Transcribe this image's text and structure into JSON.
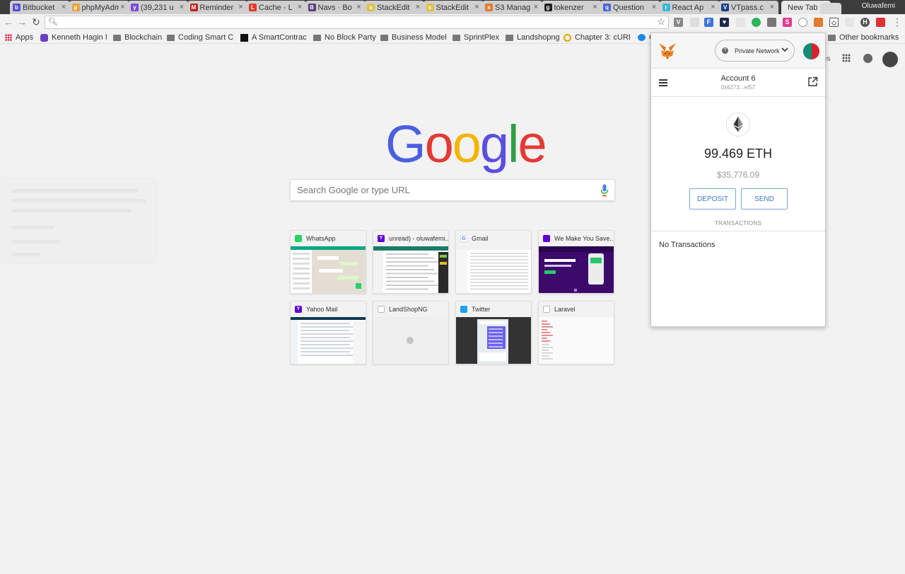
{
  "browser": {
    "tabs": [
      {
        "label": "Bitbucket",
        "color": "#5a4bd6",
        "glyph": "b"
      },
      {
        "label": "phpMyAdmin",
        "color": "#e8a33c",
        "glyph": "p"
      },
      {
        "label": "(39,231 u",
        "color": "#7b4bd6",
        "glyph": "y"
      },
      {
        "label": "Reminder",
        "color": "#c5221f",
        "glyph": "M"
      },
      {
        "label": "Cache - L",
        "color": "#e23a2f",
        "glyph": "L"
      },
      {
        "label": "Navs · Bo",
        "color": "#563d7c",
        "glyph": "B"
      },
      {
        "label": "StackEdit",
        "color": "#e0c24a",
        "glyph": "s"
      },
      {
        "label": "StackEdit",
        "color": "#e0c24a",
        "glyph": "s"
      },
      {
        "label": "S3 Manag",
        "color": "#e07b2f",
        "glyph": "s"
      },
      {
        "label": "tokenzer",
        "color": "#222222",
        "glyph": "g"
      },
      {
        "label": "Question",
        "color": "#4b67d6",
        "glyph": "q"
      },
      {
        "label": "React Ap",
        "color": "#3bb9d8",
        "glyph": "r"
      },
      {
        "label": "VTpass.c",
        "color": "#1b3c8a",
        "glyph": "V"
      }
    ],
    "active_tab_label": "New Tab",
    "user_name": "Oluwafemi",
    "address_value": "",
    "bookmarks": {
      "apps_label": "Apps",
      "items": [
        "Kenneth Hagin M",
        "Blockchain",
        "Coding Smart Co",
        "A SmartContract",
        "No Block Party",
        "Business Model",
        "SprintPlex",
        "Landshopng",
        "Chapter 3: cURL",
        "C"
      ],
      "other_label": "Other bookmarks"
    }
  },
  "ntp": {
    "logo_letters": [
      "G",
      "o",
      "o",
      "g",
      "l",
      "e"
    ],
    "logo_colors": [
      "#4a5fe0",
      "#e53935",
      "#f4b400",
      "#5a4fe0",
      "#2e9e48",
      "#e53935"
    ],
    "search_placeholder": "Search Google or type URL",
    "tiles": [
      {
        "title": "WhatsApp",
        "fav": "#25d366",
        "thumb": "whatsapp"
      },
      {
        "title": "unread) - oluwafemi...",
        "fav": "#5f01d1",
        "thumb": "yahoo"
      },
      {
        "title": "Gmail",
        "fav": "#ffffff",
        "thumb": "gmail"
      },
      {
        "title": "We Make You Save...",
        "fav": "#5f01d1",
        "thumb": "purple"
      },
      {
        "title": "Yahoo Mail",
        "fav": "#5f01d1",
        "thumb": "yahoomail"
      },
      {
        "title": "LandShopNG",
        "fav": "#dddddd",
        "thumb": "blank"
      },
      {
        "title": "Twitter",
        "fav": "#1da1f2",
        "thumb": "twitter"
      },
      {
        "title": "Laravel",
        "fav": "#dddddd",
        "thumb": "laravel"
      }
    ],
    "header_partial_text": "es"
  },
  "metamask": {
    "network_label": "Private Network",
    "account_name": "Account 6",
    "account_address": "0x6273...ef57",
    "eth_balance": "99.469 ETH",
    "usd_balance": "$35,776.09",
    "deposit_label": "DEPOSIT",
    "send_label": "SEND",
    "transactions_label": "TRANSACTIONS",
    "no_transactions_label": "No Transactions"
  }
}
